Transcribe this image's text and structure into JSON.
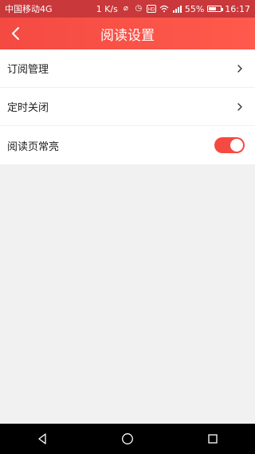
{
  "status_bar": {
    "carrier": "中国移动4G",
    "speed": "1 K/s",
    "battery": "55%",
    "time": "16:17",
    "icons": [
      "vibrate-off-icon",
      "alarm-icon",
      "wifi-icon",
      "hd-icon",
      "signal-icon"
    ]
  },
  "header": {
    "title": "阅读设置",
    "back_icon": "chevron-left-icon",
    "background_colors": [
      "#f44a42",
      "#ff5a4c"
    ]
  },
  "settings": [
    {
      "label": "订阅管理",
      "control": "chevron",
      "icon": "chevron-right-icon"
    },
    {
      "label": "定时关闭",
      "control": "chevron",
      "icon": "chevron-right-icon"
    },
    {
      "label": "阅读页常亮",
      "control": "toggle",
      "on": true
    }
  ],
  "nav_bar": {
    "buttons": [
      "back-triangle-icon",
      "home-circle-icon",
      "recent-square-icon"
    ]
  },
  "colors": {
    "accent": "#f44a42",
    "background": "#f1f1f1"
  }
}
